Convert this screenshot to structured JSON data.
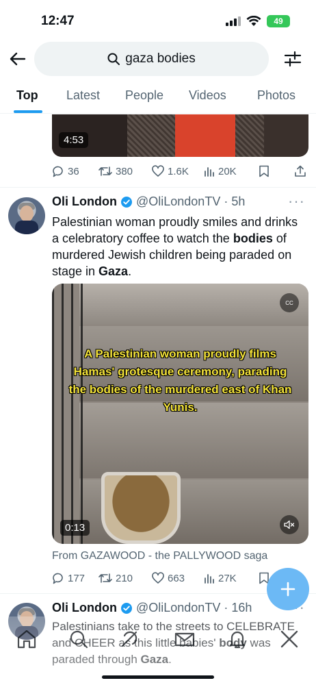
{
  "status_bar": {
    "time": "12:47",
    "battery": "49"
  },
  "search": {
    "query": "gaza bodies"
  },
  "tabs": [
    {
      "label": "Top",
      "active": true
    },
    {
      "label": "Latest",
      "active": false
    },
    {
      "label": "People",
      "active": false
    },
    {
      "label": "Videos",
      "active": false
    },
    {
      "label": "Photos",
      "active": false
    }
  ],
  "tweet1": {
    "video_duration": "4:53",
    "replies": "36",
    "retweets": "380",
    "likes": "1.6K",
    "views": "20K"
  },
  "tweet2": {
    "name": "Oli London",
    "handle": "@OliLondonTV",
    "time": "· 5h",
    "text_before_1": "Palestinian woman proudly smiles and drinks a celebratory coffee to watch the ",
    "bold_1": "bodies",
    "text_before_2": " of murdered Jewish children being paraded on stage in ",
    "bold_2": "Gaza",
    "text_end": ".",
    "video_caption": "A Palestinian woman proudly films Hamas' grotesque ceremony, parading the bodies of the murdered east of Khan Yunis.",
    "video_duration": "0:13",
    "cc_label": "CC",
    "source": "From GAZAWOOD - the PALLYWOOD saga",
    "replies": "177",
    "retweets": "210",
    "likes": "663",
    "views": "27K"
  },
  "tweet3": {
    "name": "Oli London",
    "handle": "@OliLondonTV",
    "time": "· 16h",
    "text_1": "Palestinians take to the streets to CELEBRATE and CHEER as this little babies' ",
    "bold_1": "body",
    "text_2": " was paraded through ",
    "bold_2": "Gaza",
    "text_end": "."
  },
  "colors": {
    "accent": "#1d9bf0",
    "verified": "#1d9bf0",
    "secondary_text": "#536471"
  },
  "icons": {
    "back": "arrow-left-icon",
    "search": "search-icon",
    "filter": "sliders-icon",
    "reply": "reply-icon",
    "retweet": "retweet-icon",
    "like": "heart-icon",
    "views": "bar-chart-icon",
    "bookmark": "bookmark-icon",
    "share": "share-icon",
    "compose": "plus-icon",
    "home": "home-icon",
    "explore": "search-icon",
    "communities": "communities-icon",
    "notifications": "bell-icon",
    "messages": "mail-icon",
    "grok": "grok-icon"
  }
}
